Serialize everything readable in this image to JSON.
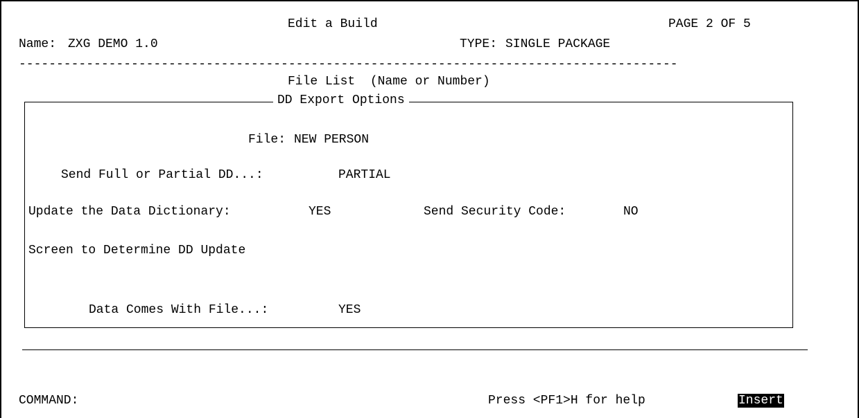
{
  "header": {
    "screen_title": "Edit a Build",
    "page_indicator": "PAGE 2 OF 5",
    "name_label": "Name:",
    "name_value": "ZXG DEMO 1.0",
    "type_label": "TYPE:",
    "type_value": "SINGLE PACKAGE",
    "separator": "----------------------------------------------------------------------------------------"
  },
  "main": {
    "section_title": "File List  (Name or Number)"
  },
  "dialog": {
    "title": "DD Export Options",
    "file_label": "File:",
    "file_value": "NEW PERSON",
    "send_dd_label": "Send Full or Partial DD...:",
    "send_dd_value": "PARTIAL",
    "update_dd_label": "Update the Data Dictionary:",
    "update_dd_value": "YES",
    "security_label": "Send Security Code:",
    "security_value": "NO",
    "screen_label": "Screen to Determine DD Update",
    "data_comes_label": "Data Comes With File...:",
    "data_comes_value": "YES"
  },
  "footer": {
    "command_label": "COMMAND:",
    "help_text": "Press <PF1>H for help",
    "mode": "Insert"
  }
}
